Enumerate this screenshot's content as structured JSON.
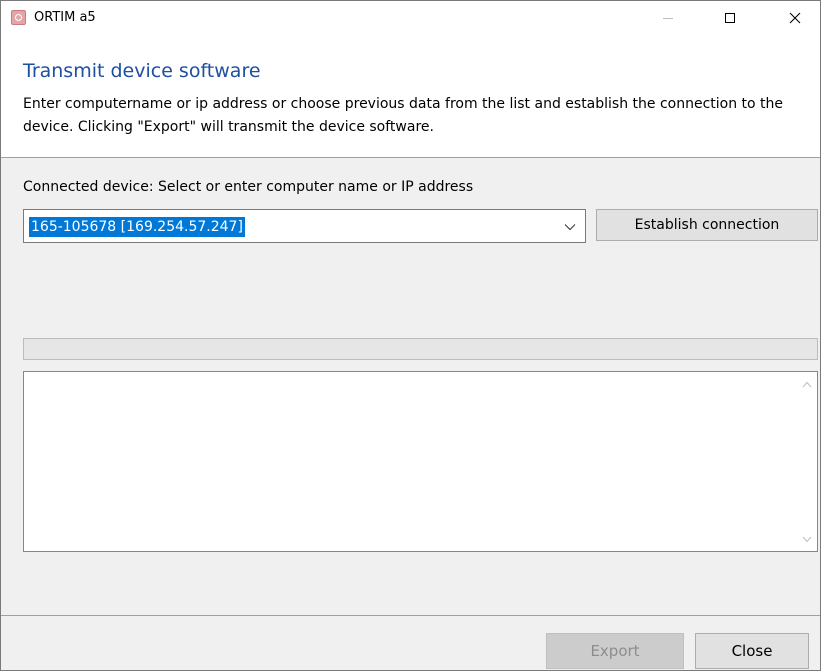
{
  "window": {
    "title": "ORTIM a5",
    "icons": {
      "app": "ortim-app-icon",
      "minimize": "minimize-icon",
      "maximize": "maximize-icon",
      "close": "close-icon"
    }
  },
  "header": {
    "title": "Transmit device software",
    "description": "Enter computername or ip address or choose previous data from the list and establish the connection to the device. Clicking \"Export\" will transmit the device software."
  },
  "connection": {
    "label": "Connected device: Select or enter computer name or IP address",
    "selected_value": "165-105678 [169.254.57.247]",
    "connect_label": "Establish connection"
  },
  "progress": {
    "value": 0
  },
  "log": {
    "text": ""
  },
  "footer": {
    "export_label": "Export",
    "export_enabled": false,
    "close_label": "Close"
  },
  "colors": {
    "header_title": "#1e4fa0",
    "selection": "#0078d7",
    "background": "#f0f0f0"
  }
}
